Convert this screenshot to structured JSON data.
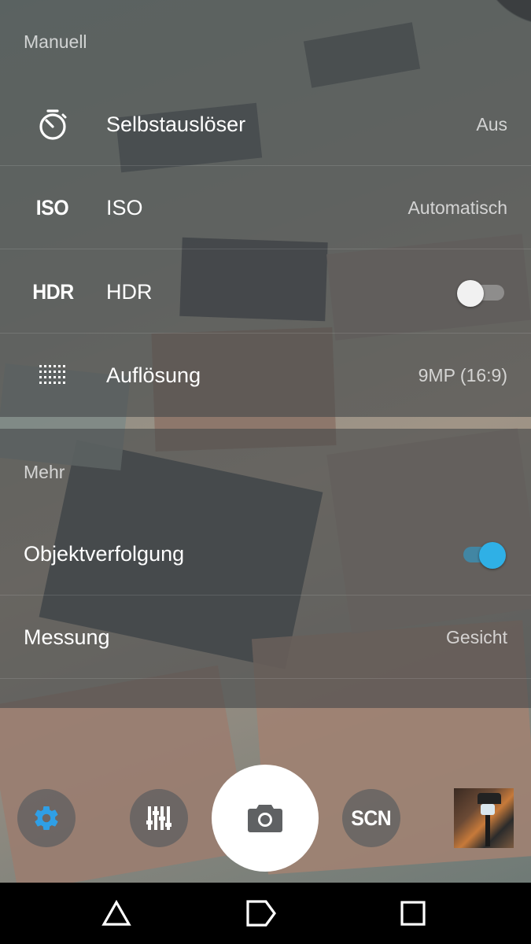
{
  "sections": {
    "manual_title": "Manuell",
    "more_title": "Mehr"
  },
  "manual": [
    {
      "id": "timer",
      "label": "Selbstauslöser",
      "value": "Aus",
      "icon": "timer-icon"
    },
    {
      "id": "iso",
      "label": "ISO",
      "value": "Automatisch",
      "icon_text": "ISO"
    },
    {
      "id": "hdr",
      "label": "HDR",
      "icon_text": "HDR",
      "toggle": false
    },
    {
      "id": "resolution",
      "label": "Auflösung",
      "value": "9MP (16:9)",
      "icon": "grid-icon"
    }
  ],
  "more": [
    {
      "id": "tracking",
      "label": "Objektverfolgung",
      "toggle": true
    },
    {
      "id": "metering",
      "label": "Messung",
      "value": "Gesicht"
    }
  ],
  "controls": {
    "scn_label": "SCN"
  },
  "colors": {
    "accent": "#2fb0e6",
    "settings_icon": "#2f9fe6"
  }
}
